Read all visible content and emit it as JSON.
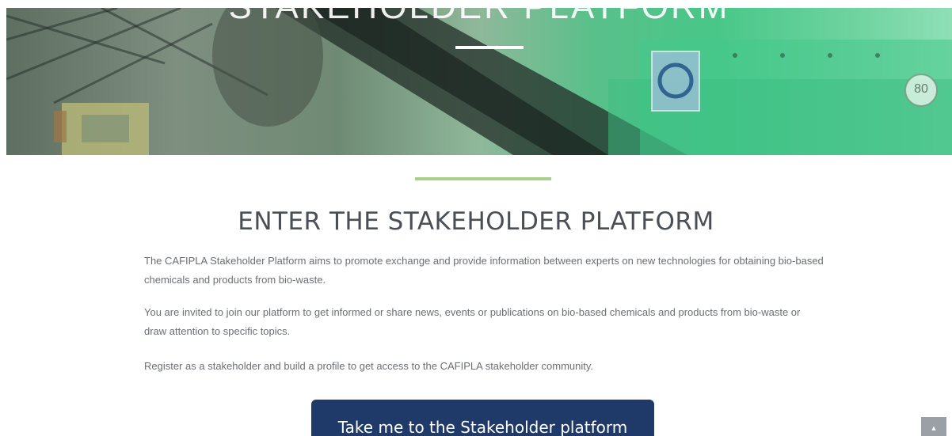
{
  "hero": {
    "title": "STAKEHOLDER PLATFORM",
    "badge_number": "80"
  },
  "section": {
    "heading": "ENTER THE STAKEHOLDER PLATFORM",
    "paragraphs": [
      "The CAFIPLA Stakeholder Platform aims to promote exchange and provide information between experts on new technologies for obtaining bio-based chemicals and products from bio-waste.",
      "You are invited to join our platform to get informed or share news, events or publications on bio-based chemicals and products from bio-waste or draw attention to  specific topics.",
      "Register as a stakeholder and build a profile to get access to the CAFIPLA stakeholder community."
    ]
  },
  "cta": {
    "label": "Take me to the Stakeholder platform"
  },
  "scroll_top": {
    "icon": "chevron-up-icon",
    "glyph": "▲"
  },
  "colors": {
    "accent_green": "#a8d08d",
    "button_navy": "#1f3a68",
    "heading_gray": "#4a4f57",
    "text_gray": "#6b6f74"
  }
}
